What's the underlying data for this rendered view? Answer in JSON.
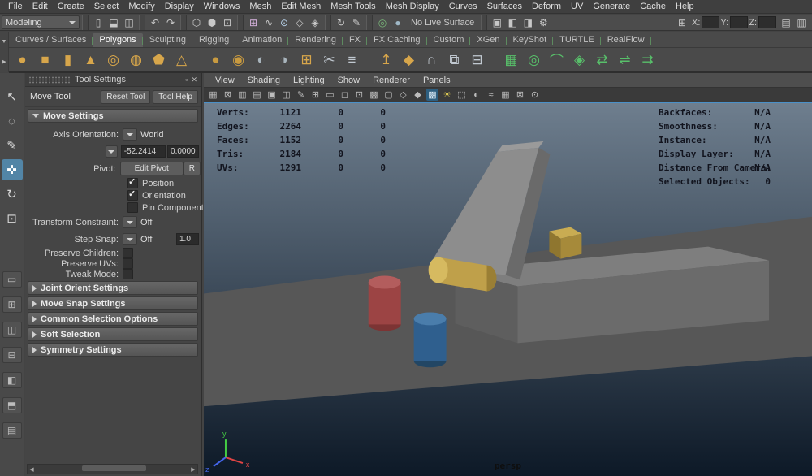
{
  "menubar": {
    "items": [
      {
        "label": "File"
      },
      {
        "label": "Edit"
      },
      {
        "label": "Create"
      },
      {
        "label": "Select"
      },
      {
        "label": "Modify"
      },
      {
        "label": "Display"
      },
      {
        "label": "Windows"
      },
      {
        "label": "Mesh"
      },
      {
        "label": "Edit Mesh"
      },
      {
        "label": "Mesh Tools"
      },
      {
        "label": "Mesh Display"
      },
      {
        "label": "Curves"
      },
      {
        "label": "Surfaces"
      },
      {
        "label": "Deform"
      },
      {
        "label": "UV"
      },
      {
        "label": "Generate"
      },
      {
        "label": "Cache"
      },
      {
        "label": "Help"
      }
    ]
  },
  "statusline": {
    "menuset": "Modeling",
    "no_live_surface": "No Live Surface",
    "file_icons": [
      {
        "name": "new-scene-icon",
        "glyph": "▯"
      },
      {
        "name": "open-scene-icon",
        "glyph": "⬓"
      },
      {
        "name": "save-scene-icon",
        "glyph": "◫"
      }
    ],
    "undo_icons": [
      {
        "name": "undo-icon",
        "glyph": "↶"
      },
      {
        "name": "redo-icon",
        "glyph": "↷"
      }
    ],
    "select_icons": [
      {
        "name": "select-hierarchy-icon",
        "glyph": "⬡"
      },
      {
        "name": "select-object-icon",
        "glyph": "⬢"
      },
      {
        "name": "select-component-icon",
        "glyph": "⊡"
      }
    ],
    "snap_icons": [
      {
        "name": "snap-grid-icon",
        "glyph": "⊞",
        "color": "#d9b3e0"
      },
      {
        "name": "snap-curve-icon",
        "glyph": "∿",
        "color": "#c8c8c8"
      },
      {
        "name": "snap-point-icon",
        "glyph": "⊙",
        "color": "#b7d2ea"
      },
      {
        "name": "snap-plane-icon",
        "glyph": "◇",
        "color": "#c8c8c8"
      },
      {
        "name": "make-live-icon",
        "glyph": "◈",
        "color": "#c8c8c8"
      }
    ],
    "history_icons": [
      {
        "name": "construction-history-icon",
        "glyph": "↻"
      },
      {
        "name": "paint-effects-icon",
        "glyph": "✎"
      }
    ],
    "live_icons": [
      {
        "name": "live-surface-ring-icon",
        "glyph": "◎",
        "color": "#79b879"
      },
      {
        "name": "live-surface-dot-icon",
        "glyph": "●",
        "color": "#9fb7c6"
      }
    ],
    "render_icons": [
      {
        "name": "open-render-view-icon",
        "glyph": "▣"
      },
      {
        "name": "render-current-frame-icon",
        "glyph": "◧"
      },
      {
        "name": "ipr-render-icon",
        "glyph": "◨"
      },
      {
        "name": "render-settings-icon",
        "glyph": "⚙"
      }
    ],
    "grid_icon": {
      "glyph": "⊞"
    },
    "axis_fields": [
      {
        "label": "X:"
      },
      {
        "label": "Y:"
      },
      {
        "label": "Z:"
      }
    ],
    "sidebar_icons": [
      {
        "name": "channel-box-icon",
        "glyph": "▤"
      },
      {
        "name": "attribute-editor-icon",
        "glyph": "▥"
      }
    ]
  },
  "shelf": {
    "tabs": [
      {
        "label": "Curves / Surfaces"
      },
      {
        "label": "Polygons",
        "active": true
      },
      {
        "label": "Sculpting"
      },
      {
        "label": "Rigging"
      },
      {
        "label": "Animation"
      },
      {
        "label": "Rendering"
      },
      {
        "label": "FX"
      },
      {
        "label": "FX Caching"
      },
      {
        "label": "Custom"
      },
      {
        "label": "XGen"
      },
      {
        "label": "KeyShot"
      },
      {
        "label": "TURTLE"
      },
      {
        "label": "RealFlow"
      }
    ],
    "icons": [
      {
        "name": "poly-sphere-icon",
        "glyph": "●",
        "color": "#d7a64b"
      },
      {
        "name": "poly-cube-icon",
        "glyph": "■",
        "color": "#d7a64b"
      },
      {
        "name": "poly-cylinder-icon",
        "glyph": "▮",
        "color": "#d7a64b"
      },
      {
        "name": "poly-cone-icon",
        "glyph": "▲",
        "color": "#d7a64b"
      },
      {
        "name": "poly-torus-icon",
        "glyph": "◎",
        "color": "#d7a64b"
      },
      {
        "name": "poly-pipe-icon",
        "glyph": "◍",
        "color": "#d7a64b"
      },
      {
        "name": "poly-prism-icon",
        "glyph": "⬟",
        "color": "#d7a64b"
      },
      {
        "name": "poly-pyramid-icon",
        "glyph": "△",
        "color": "#d7a64b"
      },
      {
        "name": "sculpt-sphere-icon",
        "glyph": "●",
        "color": "#c89a40",
        "group": true
      },
      {
        "name": "smooth-sphere-icon",
        "glyph": "◉",
        "color": "#c89a40"
      },
      {
        "name": "boolean-union-icon",
        "glyph": "◐",
        "color": "#a8b4bc"
      },
      {
        "name": "boolean-difference-icon",
        "glyph": "◑",
        "color": "#a8b4bc"
      },
      {
        "name": "lattice-icon",
        "glyph": "⊞",
        "color": "#d7a64b"
      },
      {
        "name": "multi-cut-icon",
        "glyph": "✂",
        "color": "#c0c8d0"
      },
      {
        "name": "insert-edge-loop-icon",
        "glyph": "≡",
        "color": "#c0c8d0"
      },
      {
        "name": "extrude-icon",
        "glyph": "↥",
        "color": "#d7a64b",
        "group": true
      },
      {
        "name": "bevel-icon",
        "glyph": "◆",
        "color": "#d7a64b"
      },
      {
        "name": "bridge-icon",
        "glyph": "∩",
        "color": "#c0c8d0"
      },
      {
        "name": "combine-icon",
        "glyph": "⧉",
        "color": "#c0c8d0"
      },
      {
        "name": "separate-icon",
        "glyph": "⊟",
        "color": "#c0c8d0"
      },
      {
        "name": "quad-draw-icon",
        "glyph": "▦",
        "color": "#58c06a",
        "group": true
      },
      {
        "name": "target-weld-icon",
        "glyph": "◎",
        "color": "#58c06a"
      },
      {
        "name": "connect-icon",
        "glyph": "⌒",
        "color": "#58c06a"
      },
      {
        "name": "make-live-shelf-icon",
        "glyph": "◈",
        "color": "#58c06a"
      },
      {
        "name": "mirror-icon",
        "glyph": "⇄",
        "color": "#58c06a"
      },
      {
        "name": "symmetrize-icon",
        "glyph": "⇌",
        "color": "#58c06a"
      },
      {
        "name": "flip-icon",
        "glyph": "⇉",
        "color": "#58c06a"
      }
    ]
  },
  "toolbox": {
    "tools": [
      {
        "name": "select-tool",
        "glyph": "↖"
      },
      {
        "name": "lasso-tool",
        "glyph": "◌"
      },
      {
        "name": "paint-select-tool",
        "glyph": "✎"
      },
      {
        "name": "move-tool",
        "glyph": "✜",
        "active": true
      },
      {
        "name": "rotate-tool",
        "glyph": "↻"
      },
      {
        "name": "scale-tool",
        "glyph": "⊡"
      }
    ],
    "layouts": [
      {
        "name": "layout-single-pane",
        "glyph": "▭"
      },
      {
        "name": "layout-four-pane",
        "glyph": "⊞"
      },
      {
        "name": "layout-two-pane-side",
        "glyph": "◫"
      },
      {
        "name": "layout-two-pane-stacked",
        "glyph": "⊟"
      },
      {
        "name": "layout-outliner-persp",
        "glyph": "◧"
      },
      {
        "name": "layout-persp-graph",
        "glyph": "⬒"
      },
      {
        "name": "layout-hypershade-persp",
        "glyph": "▤"
      }
    ]
  },
  "tool_settings": {
    "panel_title": "Tool Settings",
    "tool_name": "Move Tool",
    "reset_button": "Reset Tool",
    "help_button": "Tool Help",
    "move_settings_header": "Move Settings",
    "rows": {
      "axis_orientation_label": "Axis Orientation:",
      "axis_orientation_value": "World",
      "axis_values": [
        "-52.2414",
        "0.0000"
      ],
      "pivot_label": "Pivot:",
      "edit_pivot_button": "Edit Pivot",
      "reset_pivot_button": "R",
      "transform_constraint_label": "Transform Constraint:",
      "transform_constraint_value": "Off",
      "step_snap_label": "Step Snap:",
      "step_snap_value": "Off",
      "step_snap_size": "1.0"
    },
    "pivot_checkboxes": [
      {
        "label": "Position",
        "checked": true
      },
      {
        "label": "Orientation",
        "checked": true
      },
      {
        "label": "Pin Component Pivot",
        "checked": false
      }
    ],
    "option_checkboxes": [
      {
        "label": "Preserve Children:",
        "checked": false
      },
      {
        "label": "Preserve UVs:",
        "checked": false
      },
      {
        "label": "Tweak Mode:",
        "checked": false
      }
    ],
    "collapsed_sections": [
      {
        "label": "Joint Orient Settings"
      },
      {
        "label": "Move Snap Settings"
      },
      {
        "label": "Common Selection Options"
      },
      {
        "label": "Soft Selection"
      },
      {
        "label": "Symmetry Settings"
      }
    ]
  },
  "viewport": {
    "menus": [
      {
        "label": "View"
      },
      {
        "label": "Shading"
      },
      {
        "label": "Lighting"
      },
      {
        "label": "Show"
      },
      {
        "label": "Renderer"
      },
      {
        "label": "Panels"
      }
    ],
    "toolbar_icons": [
      {
        "name": "select-camera-icon",
        "glyph": "▦"
      },
      {
        "name": "lock-camera-icon",
        "glyph": "⊠"
      },
      {
        "name": "camera-attributes-icon",
        "glyph": "▥"
      },
      {
        "name": "bookmarks-icon",
        "glyph": "▤"
      },
      {
        "name": "image-plane-icon",
        "glyph": "▣"
      },
      {
        "name": "two-d-pan-zoom-icon",
        "glyph": "◫"
      },
      {
        "name": "grease-pencil-icon",
        "glyph": "✎"
      },
      {
        "name": "grid-toggle-icon",
        "glyph": "⊞"
      },
      {
        "name": "film-gate-icon",
        "glyph": "▭"
      },
      {
        "name": "resolution-gate-icon",
        "glyph": "◻"
      },
      {
        "name": "gate-mask-icon",
        "glyph": "⊡"
      },
      {
        "name": "field-chart-icon",
        "glyph": "▩"
      },
      {
        "name": "safe-action-icon",
        "glyph": "▢"
      },
      {
        "name": "wireframe-icon",
        "glyph": "◇"
      },
      {
        "name": "shaded-icon",
        "glyph": "◆"
      },
      {
        "name": "textured-icon",
        "glyph": "▩",
        "active": true
      },
      {
        "name": "use-all-lights-icon",
        "glyph": "☀",
        "color": "#e2ce52"
      },
      {
        "name": "shadows-icon",
        "glyph": "⬚"
      },
      {
        "name": "occlusion-icon",
        "glyph": "◐"
      },
      {
        "name": "motion-blur-icon",
        "glyph": "≈"
      },
      {
        "name": "multisample-icon",
        "glyph": "▦"
      },
      {
        "name": "xray-icon",
        "glyph": "⊠"
      },
      {
        "name": "isolate-select-icon",
        "glyph": "⊙"
      }
    ],
    "hud_left": [
      {
        "label": "Verts:",
        "value": "1121",
        "c2": "0",
        "c3": "0"
      },
      {
        "label": "Edges:",
        "value": "2264",
        "c2": "0",
        "c3": "0"
      },
      {
        "label": "Faces:",
        "value": "1152",
        "c2": "0",
        "c3": "0"
      },
      {
        "label": "Tris:",
        "value": "2184",
        "c2": "0",
        "c3": "0"
      },
      {
        "label": "UVs:",
        "value": "1291",
        "c2": "0",
        "c3": "0"
      }
    ],
    "hud_right": [
      {
        "label": "Backfaces:",
        "value": "N/A"
      },
      {
        "label": "Smoothness:",
        "value": "N/A"
      },
      {
        "label": "Instance:",
        "value": "N/A"
      },
      {
        "label": "Display Layer:",
        "value": "N/A"
      },
      {
        "label": "Distance From Camera:",
        "value": "N/A"
      },
      {
        "label": "Selected Objects:",
        "value": "0"
      }
    ],
    "camera_label": "persp",
    "axis_labels": {
      "x": "x",
      "y": "y",
      "z": "z"
    }
  },
  "scene": {
    "sky_top": "#6e7e8e",
    "sky_bottom": "#0d1927",
    "ground": "#575757",
    "slab_top": "#7e7e7e",
    "slab_front": "#6b6b6b",
    "slab_side": "#5e5e5e",
    "ramp_top": "#8d8d8d",
    "ramp_side": "#6a6a6a",
    "ramp_end": "#9a9a9a",
    "gold_box_top": "#c9ac52",
    "gold_box_front": "#a68a3a",
    "gold_box_side": "#8f762f",
    "gold_cyl_body": "#bfa04a",
    "gold_cyl_cap": "#d6ba60",
    "gold_cyl_end": "#9a7f35",
    "red_cyl_body": "#9c4444",
    "red_cyl_top": "#b35d5d",
    "red_cyl_bottom": "#7c3434",
    "blue_cyl_body": "#2f5f8e",
    "blue_cyl_top": "#4a7dab",
    "blue_cyl_bottom": "#224664",
    "axis_x": "#e04444",
    "axis_y": "#44cc44",
    "axis_z": "#4466ee",
    "accent_blue": "#5285a6",
    "active_panel_border": "#4a90c8"
  }
}
